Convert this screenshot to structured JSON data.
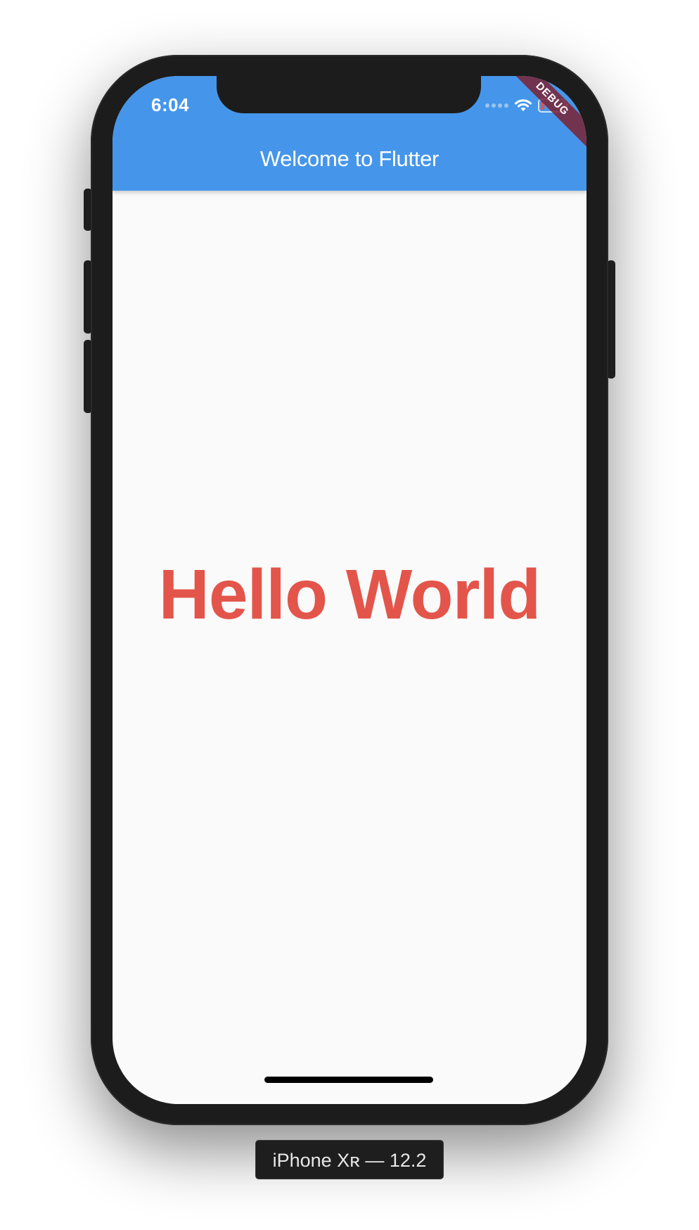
{
  "status_bar": {
    "time": "6:04",
    "icons": [
      "cellular-signal-icon",
      "wifi-icon",
      "battery-icon"
    ]
  },
  "app_bar": {
    "title": "Welcome to Flutter",
    "color": "#4596ea"
  },
  "debug_banner": {
    "label": "DEBUG"
  },
  "body": {
    "text": "Hello World",
    "text_color": "#e3554a",
    "background": "#fafafa"
  },
  "device_label": {
    "text": "iPhone Xʀ — 12.2"
  }
}
